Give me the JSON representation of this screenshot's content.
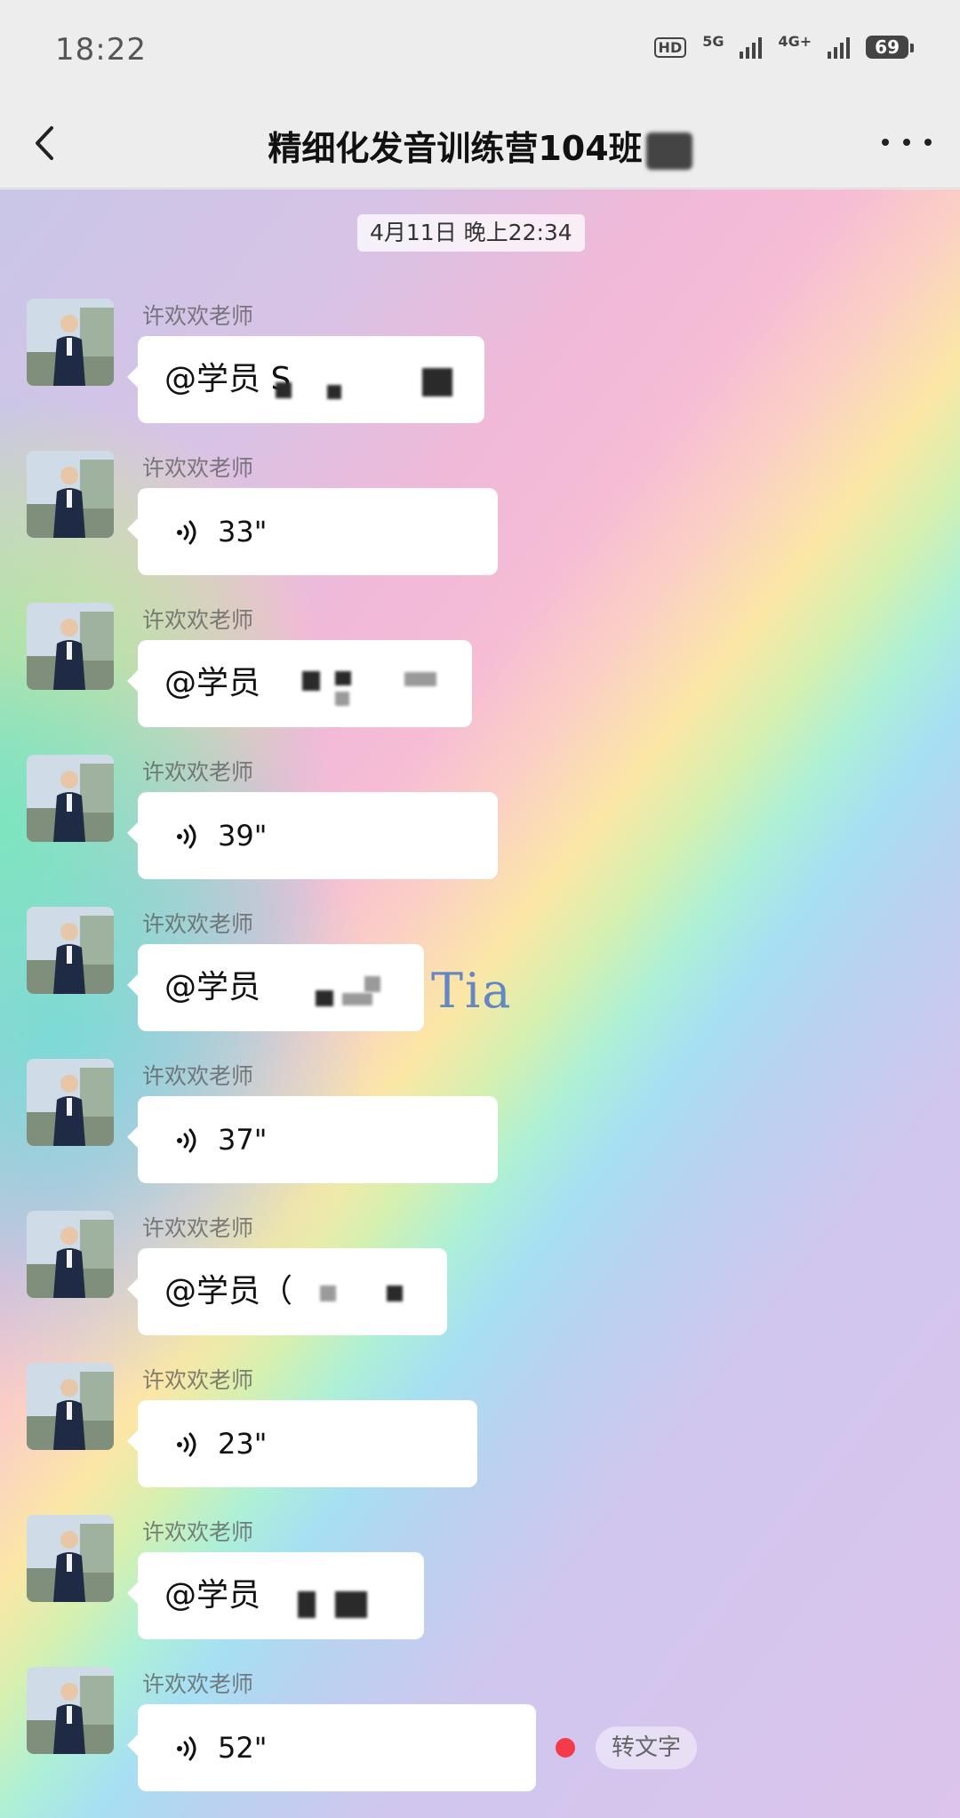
{
  "status_bar": {
    "time": "18:22",
    "hd": "HD",
    "network_1": "5G",
    "network_2": "4G+",
    "battery": "69"
  },
  "header": {
    "title": "精细化发音训练营104班",
    "back_icon": "chevron-left-icon",
    "more_icon": "more-dots-icon"
  },
  "chat": {
    "time_divider": "4月11日 晚上22:34",
    "watermark": "Tia",
    "messages": [
      {
        "sender": "许欢欢老师",
        "type": "text",
        "text": "@学员 S"
      },
      {
        "sender": "许欢欢老师",
        "type": "voice",
        "duration": "33\""
      },
      {
        "sender": "许欢欢老师",
        "type": "text",
        "text": "@学员 "
      },
      {
        "sender": "许欢欢老师",
        "type": "voice",
        "duration": "39\""
      },
      {
        "sender": "许欢欢老师",
        "type": "text",
        "text": "@学员"
      },
      {
        "sender": "许欢欢老师",
        "type": "voice",
        "duration": "37\""
      },
      {
        "sender": "许欢欢老师",
        "type": "text",
        "text": "@学员（"
      },
      {
        "sender": "许欢欢老师",
        "type": "voice",
        "duration": "23\""
      },
      {
        "sender": "许欢欢老师",
        "type": "text",
        "text": "@学员"
      },
      {
        "sender": "许欢欢老师",
        "type": "voice",
        "duration": "52\"",
        "unread": true,
        "convert_label": "转文字"
      }
    ]
  },
  "colors": {
    "unread_dot": "#f43b4a",
    "bubble": "#ffffff",
    "background": "#ededed"
  }
}
